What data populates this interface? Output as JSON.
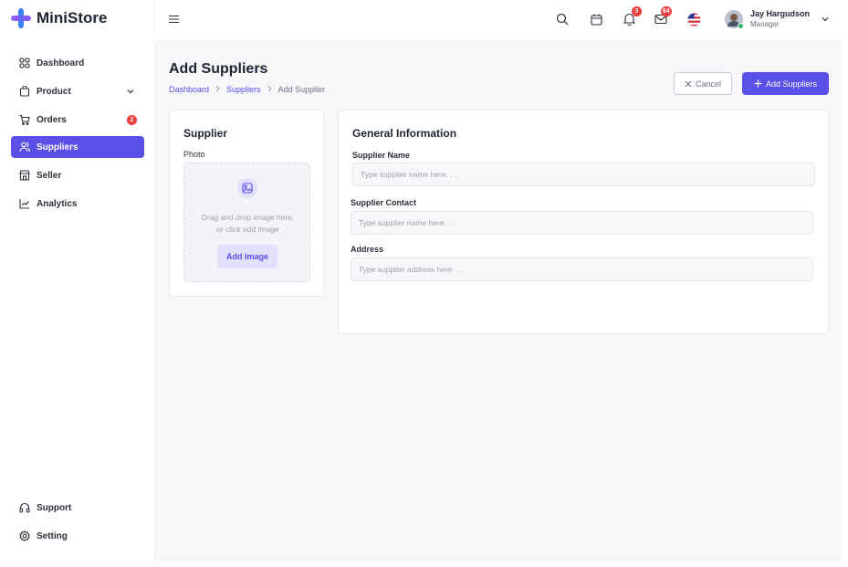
{
  "app": {
    "name": "MiniStore"
  },
  "sidebar": {
    "items": [
      {
        "label": "Dashboard",
        "icon": "grid-icon"
      },
      {
        "label": "Product",
        "icon": "bag-icon"
      },
      {
        "label": "Orders",
        "icon": "cart-icon",
        "badge": "2"
      },
      {
        "label": "Suppliers",
        "icon": "users-icon",
        "active": true
      },
      {
        "label": "Seller",
        "icon": "store-icon"
      },
      {
        "label": "Analytics",
        "icon": "chart-icon"
      }
    ],
    "bottom": [
      {
        "label": "Support",
        "icon": "headset-icon"
      },
      {
        "label": "Setting",
        "icon": "gear-icon"
      }
    ]
  },
  "topbar": {
    "notifications_badge": "3",
    "messages_badge": "64",
    "user": {
      "name": "Jay Hargudson",
      "role": "Manager"
    }
  },
  "page": {
    "title": "Add Suppliers",
    "breadcrumb": [
      "Dashboard",
      "Suppliers",
      "Add Supplier"
    ],
    "cancel_label": "Cancel",
    "add_label": "Add Suppliers"
  },
  "supplier_card": {
    "title": "Supplier",
    "photo_label": "Photo",
    "dropzone_text_1": "Drag and drop image here,",
    "dropzone_text_2": "or click add image",
    "add_image_label": "Add Image"
  },
  "general_info": {
    "title": "General Information",
    "fields": [
      {
        "label": "Supplier Name",
        "placeholder": "Type supplier name here. . ."
      },
      {
        "label": "Supplier Contact",
        "placeholder": "Type supplier name here. . ."
      },
      {
        "label": "Address",
        "placeholder": "Type supplier address here. . ."
      }
    ]
  },
  "colors": {
    "accent": "#5a4fe6",
    "badge": "#ef3b3b",
    "online": "#2fb86b"
  }
}
